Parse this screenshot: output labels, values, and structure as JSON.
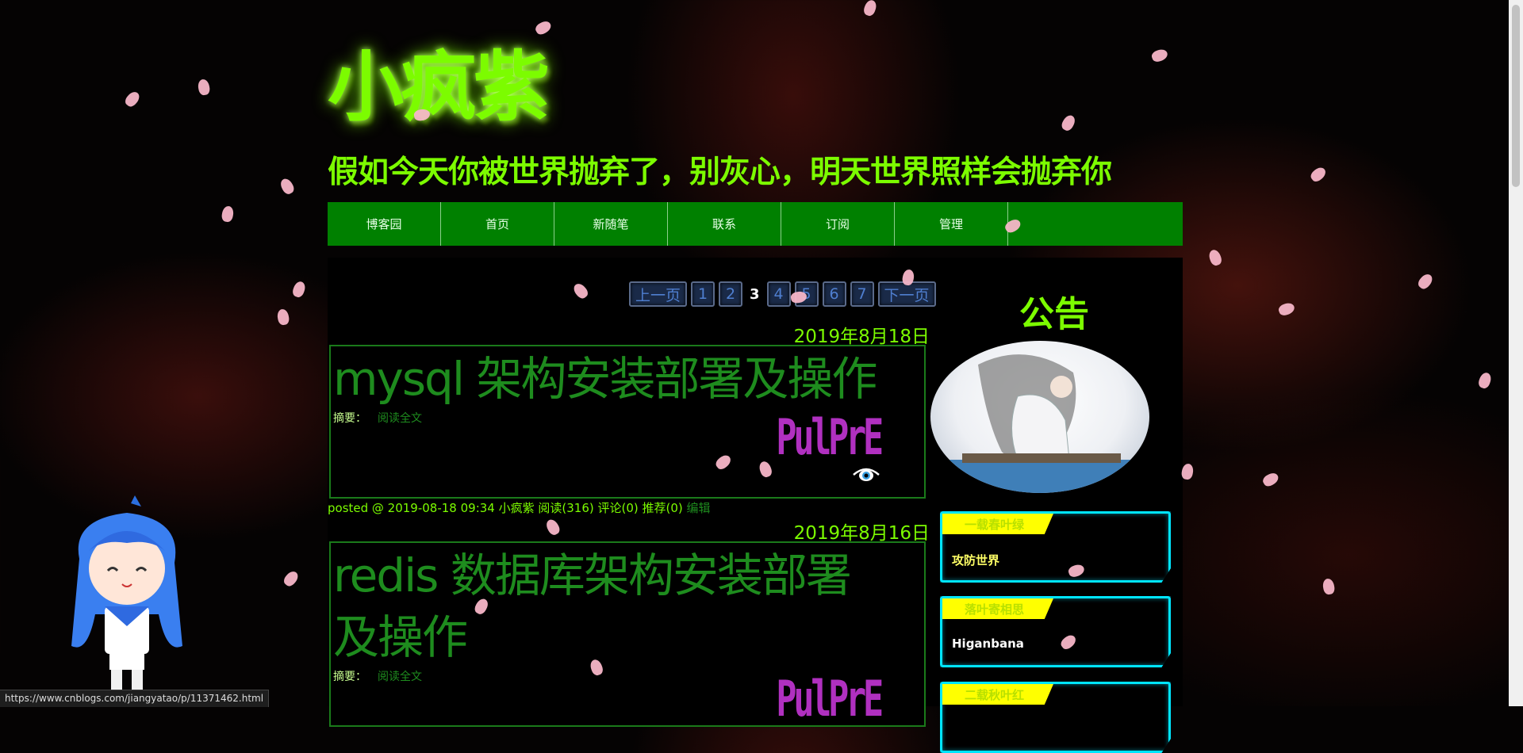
{
  "header": {
    "title": "小疯紫",
    "subtitle": "假如今天你被世界抛弃了，别灰心，明天世界照样会抛弃你"
  },
  "nav": {
    "items": [
      {
        "label": "博客园"
      },
      {
        "label": "首页"
      },
      {
        "label": "新随笔"
      },
      {
        "label": "联系"
      },
      {
        "label": "订阅"
      },
      {
        "label": "管理"
      }
    ]
  },
  "pager": {
    "prev": "上一页",
    "pages": [
      "1",
      "2",
      "3",
      "4",
      "5",
      "6",
      "7"
    ],
    "current": "3",
    "next": "下一页"
  },
  "posts": [
    {
      "date": "2019年8月18日",
      "title": "mysql 架构安装部署及操作",
      "summary_label": "摘要：",
      "read_more": "阅读全文",
      "logo_text": "PulPrE",
      "footer": "posted @ 2019-08-18 09:34 小疯紫 阅读(316) 评论(0) 推荐(0)",
      "edit": "编辑"
    },
    {
      "date": "2019年8月16日",
      "title": "redis 数据库架构安装部署及操作",
      "summary_label": "摘要：",
      "read_more": "阅读全文",
      "logo_text": "PulPrE"
    }
  ],
  "sidebar": {
    "notice_title": "公告",
    "cards": [
      {
        "tag": "一载春叶绿",
        "text": "攻防世界",
        "text_color": "#ffff66"
      },
      {
        "tag": "落叶寄相思",
        "text": "Higanbana",
        "text_color": "#ffffff"
      },
      {
        "tag": "二载秋叶红",
        "text": ""
      }
    ]
  },
  "status_bar": {
    "url": "https://www.cnblogs.com/jiangyatao/p/11371462.html"
  },
  "colors": {
    "accent": "#7cfc00",
    "nav_bg": "#008000",
    "card_glow": "#00e5ff",
    "card_tag": "#ffff00"
  }
}
